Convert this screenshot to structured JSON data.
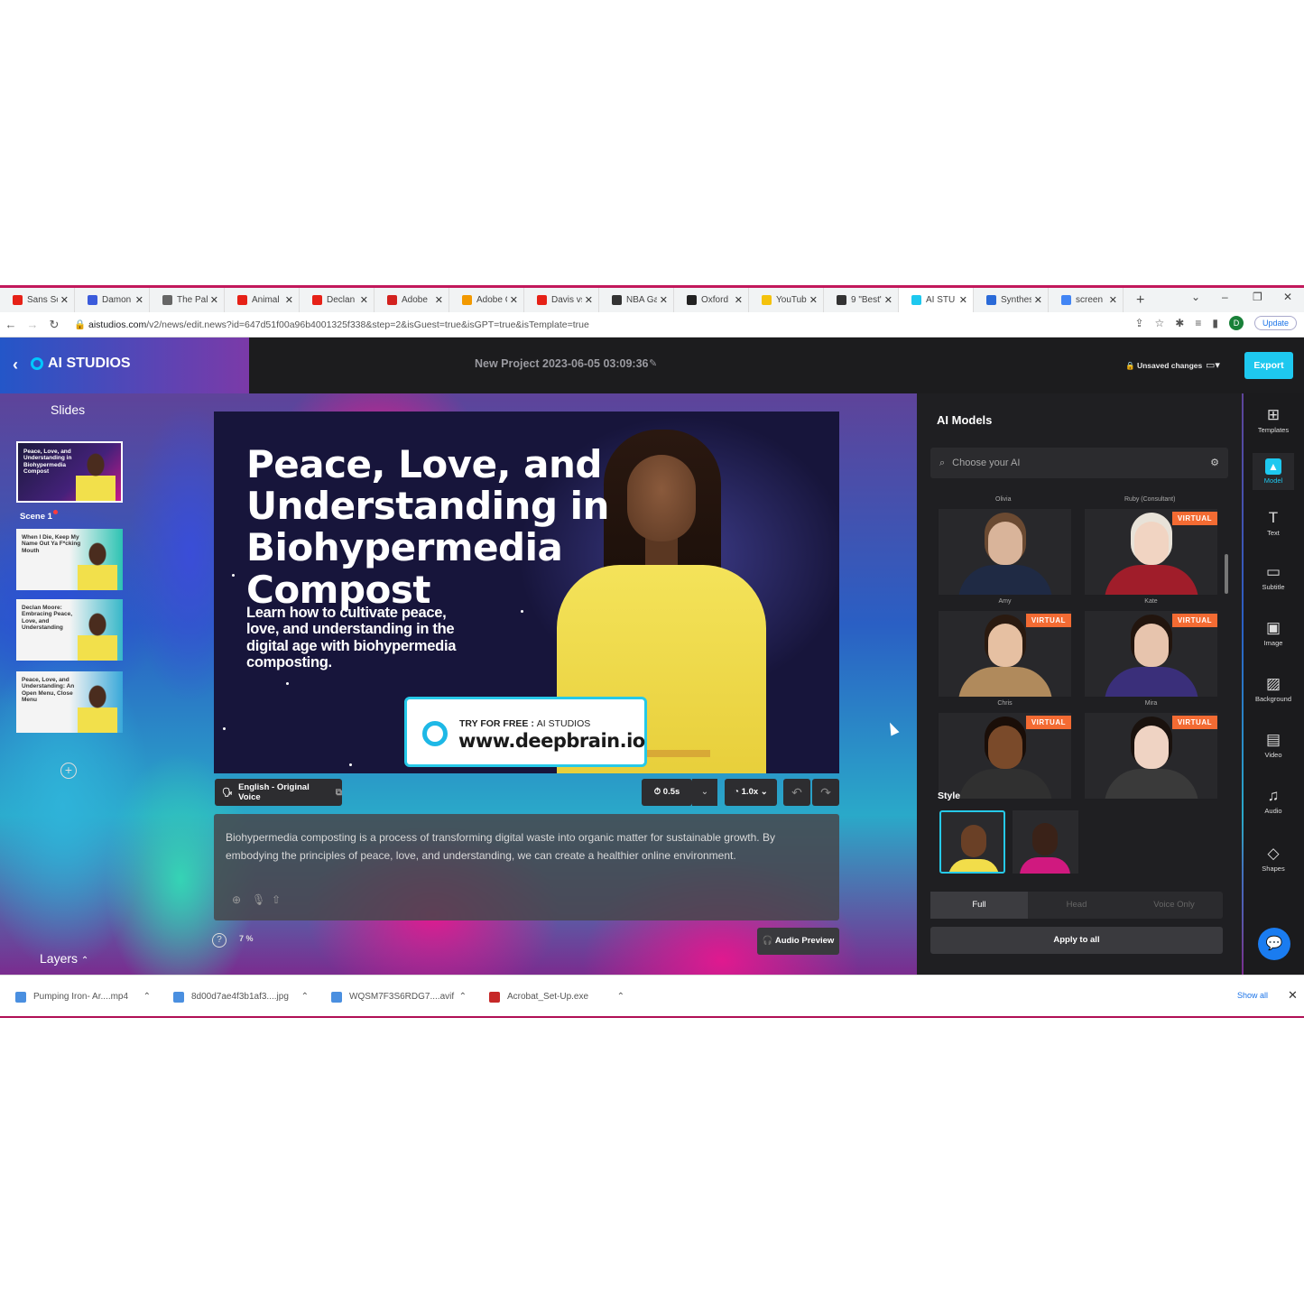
{
  "browser": {
    "tabs": [
      {
        "label": "Sans Sol",
        "color": "#e62117"
      },
      {
        "label": "Damon",
        "color": "#3b5bdb"
      },
      {
        "label": "The Pali",
        "color": "#666666"
      },
      {
        "label": "Animal",
        "color": "#e62117"
      },
      {
        "label": "Declan",
        "color": "#e62117"
      },
      {
        "label": "Adobe",
        "color": "#d3221f"
      },
      {
        "label": "Adobe C",
        "color": "#f29900"
      },
      {
        "label": "Davis vs",
        "color": "#e62117"
      },
      {
        "label": "NBA Ga",
        "color": "#333333"
      },
      {
        "label": "Oxford",
        "color": "#222222"
      },
      {
        "label": "YouTub",
        "color": "#f4c20d"
      },
      {
        "label": "9 \"Best\"",
        "color": "#333333"
      },
      {
        "label": "AI STU",
        "color": "#1ec8ef"
      },
      {
        "label": "Synthes",
        "color": "#2a6ad8"
      },
      {
        "label": "screen",
        "color": "#4285f4"
      }
    ],
    "new_tab": "+",
    "url_domain": "aistudios.com",
    "url_path": "/v2/news/edit.news?id=647d51f00a96b4001325f338&step=2&isGuest=true&isGPT=true&isTemplate=true",
    "profile_initial": "D",
    "update_label": "Update"
  },
  "app": {
    "logo": "AI STUDIOS",
    "project_title": "New Project 2023-06-05 03:09:36",
    "unsaved": "Unsaved changes",
    "export": "Export",
    "slides_title": "Slides",
    "scene_label": "Scene 1",
    "layers_label": "Layers",
    "thumbs": [
      "Peace, Love, and Understanding in Biohypermedia Compost",
      "When I Die, Keep My Name Out Ya F*cking Mouth",
      "Declan Moore: Embracing Peace, Love, and Understanding",
      "Peace, Love, and Understanding: An Open Menu, Close Menu"
    ]
  },
  "canvas": {
    "title": "Peace, Love, and Understanding in Biohypermedia Compost",
    "subtitle": "Learn how to cultivate peace, love, and understanding in the digital age with biohypermedia composting.",
    "promo_lead": "TRY FOR FREE : ",
    "promo_brand": "AI STUDIOS",
    "promo_url": "www.deepbrain.io"
  },
  "controls": {
    "language": "English - Original Voice",
    "pause": "0.5s",
    "speed": "1.0x",
    "script": "Biohypermedia composting is a process of transforming digital waste into organic matter for sustainable growth. By embodying the principles of peace, love, and understanding, we can create a healthier online environment.",
    "zoom": "7 %",
    "audio_preview": "Audio Preview"
  },
  "models": {
    "title": "AI Models",
    "search_placeholder": "Choose your AI",
    "top_names": [
      "Olivia",
      "Ruby (Consultant)"
    ],
    "virtual_badge": "VIRTUAL",
    "cards": [
      {
        "name": "Amy",
        "virtual": false,
        "skin": "#d9b49a",
        "hair": "#6b4a32",
        "outfit": "#1f2a44"
      },
      {
        "name": "Kate",
        "virtual": true,
        "skin": "#f1d4c2",
        "hair": "#e8e2d8",
        "outfit": "#a01d2a"
      },
      {
        "name": "Chris",
        "virtual": true,
        "skin": "#e6c0a2",
        "hair": "#2a1a10",
        "outfit": "#b08a5c"
      },
      {
        "name": "Mira",
        "virtual": true,
        "skin": "#e7c4ad",
        "hair": "#22150e",
        "outfit": "#3a2f7a"
      },
      {
        "name": "",
        "virtual": true,
        "skin": "#7a4a2a",
        "hair": "#1a0e08",
        "outfit": "#303030"
      },
      {
        "name": "",
        "virtual": true,
        "skin": "#efd3c3",
        "hair": "#1a120e",
        "outfit": "#3a3a3a"
      }
    ],
    "style_label": "Style",
    "segments": [
      "Full",
      "Head",
      "Voice Only"
    ],
    "apply_all": "Apply to all"
  },
  "rail": [
    {
      "icon": "⊞",
      "label": "Templates"
    },
    {
      "icon": "▲",
      "label": "Model"
    },
    {
      "icon": "T",
      "label": "Text"
    },
    {
      "icon": "▭",
      "label": "Subtitle"
    },
    {
      "icon": "▣",
      "label": "Image"
    },
    {
      "icon": "▨",
      "label": "Background"
    },
    {
      "icon": "▤",
      "label": "Video"
    },
    {
      "icon": "♫",
      "label": "Audio"
    },
    {
      "icon": "◇",
      "label": "Shapes"
    }
  ],
  "downloads": {
    "items": [
      {
        "name": "Pumping Iron- Ar....mp4",
        "color": "#4a8fe0"
      },
      {
        "name": "8d00d7ae4f3b1af3....jpg",
        "color": "#4a8fe0"
      },
      {
        "name": "WQSM7F3S6RDG7....avif",
        "color": "#4a8fe0"
      },
      {
        "name": "Acrobat_Set-Up.exe",
        "color": "#c62828"
      }
    ],
    "show_all": "Show all"
  }
}
